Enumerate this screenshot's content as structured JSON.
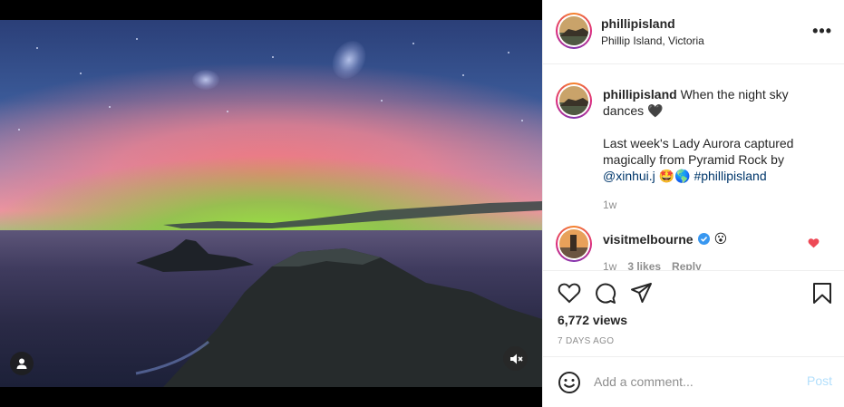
{
  "post": {
    "username": "phillipisland",
    "location": "Phillip Island, Victoria",
    "more_label": "•••"
  },
  "caption": {
    "username": "phillipisland",
    "line1": "When the night sky dances",
    "heart": "🖤",
    "line2": "Last week's Lady Aurora captured magically from Pyramid Rock by",
    "mention": "@xinhui.j",
    "emojis": "🤩🌎",
    "hashtag": "#phillipisland",
    "time": "1w"
  },
  "comment": {
    "username": "visitmelbourne",
    "text": "😮",
    "time": "1w",
    "likes": "3 likes",
    "reply": "Reply",
    "verified_color": "#3897f0",
    "liked_color": "#ed4956"
  },
  "stats": {
    "views": "6,772 views",
    "date": "7 DAYS AGO"
  },
  "add_comment": {
    "placeholder": "Add a comment...",
    "post_label": "Post",
    "emoji_icon": "smiley-icon"
  },
  "icons": {
    "like": "heart-outline-icon",
    "comment": "speech-bubble-icon",
    "share": "paper-plane-icon",
    "save": "bookmark-icon",
    "user": "person-icon",
    "mute": "speaker-muted-icon"
  }
}
